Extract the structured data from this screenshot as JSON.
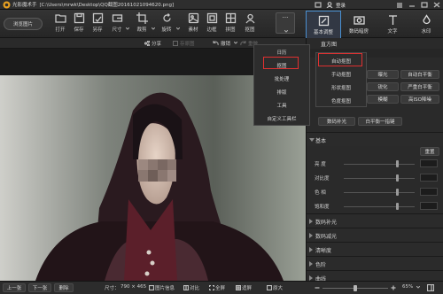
{
  "titlebar": {
    "app_name": "光影魔术手",
    "path": "[C:\\Users\\mrwk\\Desktop\\QQ截图20161021094620.png]",
    "login": "登录"
  },
  "header": {
    "browse_button": "浏览图片",
    "tools": [
      {
        "label": "打开",
        "icon": "folder-open-icon"
      },
      {
        "label": "保存",
        "icon": "save-icon"
      },
      {
        "label": "另存",
        "icon": "save-as-icon"
      },
      {
        "label": "尺寸",
        "icon": "resize-icon"
      },
      {
        "label": "裁剪",
        "icon": "crop-icon"
      },
      {
        "label": "旋转",
        "icon": "rotate-icon"
      },
      {
        "label": "素材",
        "icon": "material-icon"
      },
      {
        "label": "边框",
        "icon": "frame-icon"
      },
      {
        "label": "拼图",
        "icon": "puzzle-icon"
      },
      {
        "label": "抠图",
        "icon": "cutout-icon"
      }
    ],
    "more": "···",
    "tabs": [
      {
        "label": "基本调整",
        "active": true
      },
      {
        "label": "数码暗房",
        "active": false
      },
      {
        "label": "文字",
        "active": false
      },
      {
        "label": "水印",
        "active": false
      }
    ]
  },
  "subtoolbar": {
    "share": "分享",
    "save_as_original": "存原图",
    "undo": "撤销",
    "redo": "重做"
  },
  "more_menu": {
    "items": [
      "日历",
      "抠图",
      "批处理",
      "排版",
      "工具",
      "自定义工具栏"
    ],
    "highlighted": "抠图"
  },
  "cutout_submenu": {
    "header": "直方图",
    "items": [
      "自动抠图",
      "手动抠图",
      "形状抠图",
      "色度抠图"
    ],
    "highlighted": "自动抠图"
  },
  "panel": {
    "quick_buttons": [
      [
        "曝光",
        "自动白平衡"
      ],
      [
        "锐化",
        "严重白平衡"
      ],
      [
        "模糊",
        "高ISO降噪"
      ]
    ],
    "wide_buttons": [
      "数码补光",
      "白平衡一指键"
    ],
    "basic_section": "基本",
    "reset": "重置",
    "sliders": [
      {
        "label": "亮 度",
        "level": 0.76
      },
      {
        "label": "对比度",
        "level": 0.76
      },
      {
        "label": "色 相",
        "level": 0.76
      },
      {
        "label": "饱和度",
        "level": 0.76
      }
    ],
    "sections": [
      "数码补光",
      "数码减光",
      "清晰度",
      "色阶",
      "曲线"
    ]
  },
  "bottom_bar": {
    "prev": "上一张",
    "next": "下一张",
    "delete": "删除",
    "size_label": "尺寸：",
    "size_value": "790 × 465",
    "image_info": "图片信息",
    "compare": "对比",
    "fullscreen": "全屏",
    "fit": "适屏",
    "original": "原大",
    "zoom": "65%",
    "zoom_level": 0.5
  },
  "colors": {
    "accent_highlight": "#e03030",
    "active_tab_border": "#4a8fd0"
  }
}
